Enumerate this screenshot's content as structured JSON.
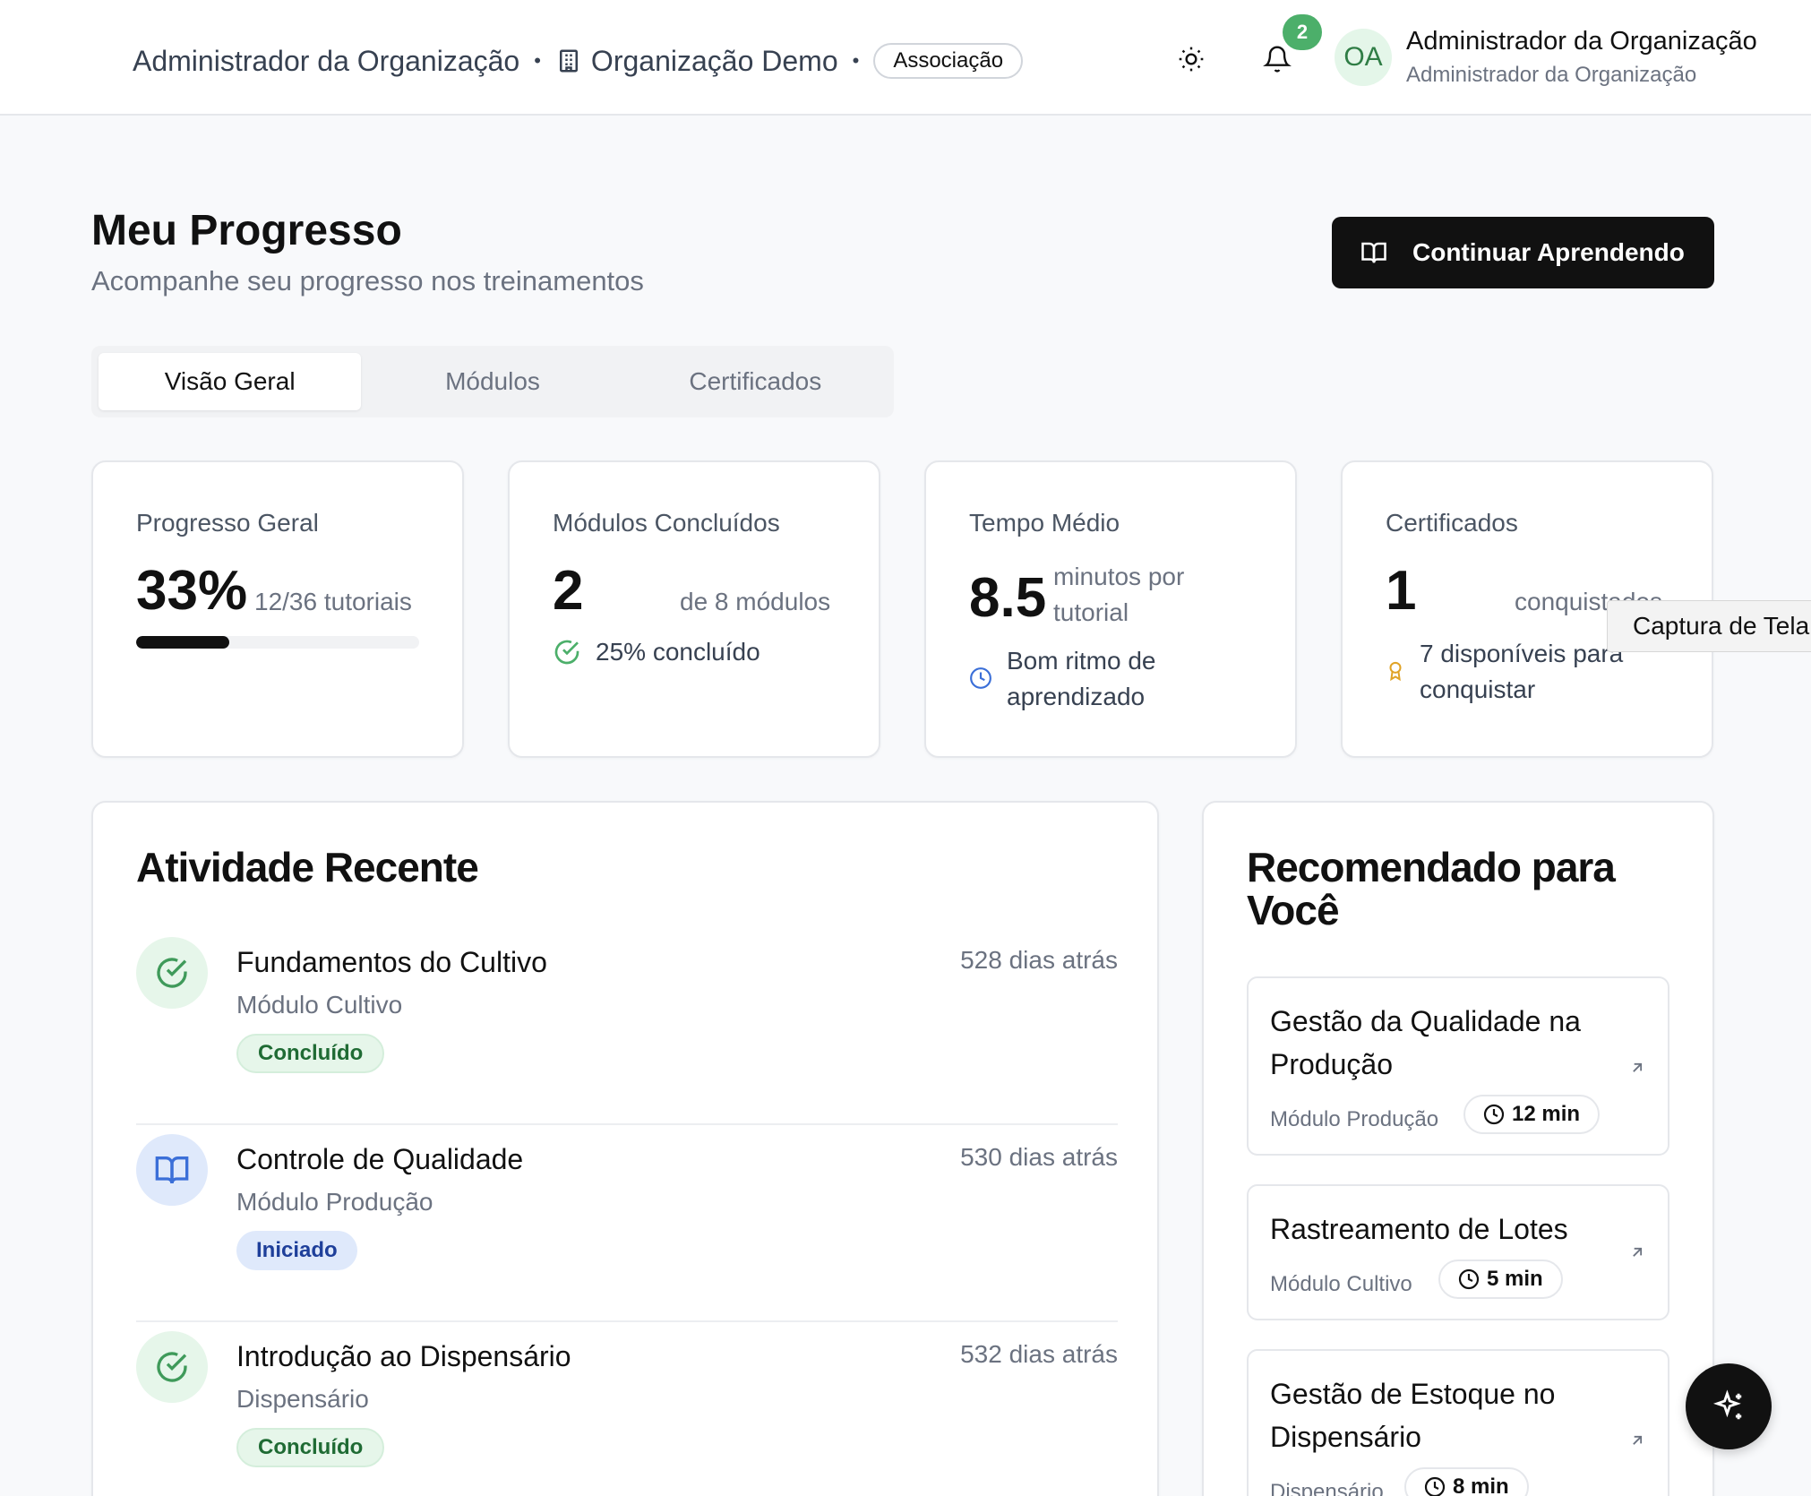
{
  "header": {
    "user_context": "Administrador da Organização",
    "org_name": "Organização Demo",
    "plan_badge": "Associação",
    "notification_count": "2",
    "avatar_initials": "OA",
    "user_name": "Administrador da Organização",
    "user_role": "Administrador da Organização",
    "icons": {
      "org": "building-icon",
      "theme": "sun-icon",
      "notifications": "bell-icon"
    }
  },
  "page": {
    "title": "Meu Progresso",
    "subtitle": "Acompanhe seu progresso nos treinamentos",
    "cta_label": "Continuar Aprendendo"
  },
  "tabs": [
    {
      "label": "Visão Geral",
      "active": true
    },
    {
      "label": "Módulos",
      "active": false
    },
    {
      "label": "Certificados",
      "active": false
    }
  ],
  "stats": {
    "progress": {
      "label": "Progresso Geral",
      "value": "33%",
      "detail": "12/36 tutoriais",
      "fraction": 0.33
    },
    "modules": {
      "label": "Módulos Concluídos",
      "value": "2",
      "detail": "de 8 módulos",
      "foot": "25% concluído"
    },
    "time": {
      "label": "Tempo Médio",
      "value": "8.5",
      "detail_line1": "minutos por",
      "detail_line2": "tutorial",
      "foot_line1": "Bom ritmo de",
      "foot_line2": "aprendizado"
    },
    "certificates": {
      "label": "Certificados",
      "value": "1",
      "detail": "conquistados",
      "foot_line1": "7 disponíveis para",
      "foot_line2": "conquistar"
    }
  },
  "activity": {
    "title": "Atividade Recente",
    "items": [
      {
        "title": "Fundamentos do Cultivo",
        "module": "Módulo Cultivo",
        "status": "Concluído",
        "time": "528 dias atrás",
        "icon": "check-circle-icon"
      },
      {
        "title": "Controle de Qualidade",
        "module": "Módulo Produção",
        "status": "Iniciado",
        "time": "530 dias atrás",
        "icon": "book-open-icon"
      },
      {
        "title": "Introdução ao Dispensário",
        "module": "Dispensário",
        "status": "Concluído",
        "time": "532 dias atrás",
        "icon": "check-circle-icon"
      }
    ]
  },
  "recommended": {
    "title_line1": "Recomendado para",
    "title_line2": "Você",
    "items": [
      {
        "title_line1": "Gestão da Qualidade na",
        "title_line2": "Produção",
        "module": "Módulo Produção",
        "duration": "12 min"
      },
      {
        "title_line1": "Rastreamento de Lotes",
        "module": "Módulo Cultivo",
        "duration": "5 min"
      },
      {
        "title_line1": "Gestão de Estoque no",
        "title_line2": "Dispensário",
        "module": "Dispensário",
        "duration": "8 min"
      }
    ]
  },
  "overlay": {
    "tooltip": "Captura de Tela"
  },
  "colors": {
    "accent": "#111111",
    "success": "#4caf6a",
    "info": "#3b6fd8",
    "award": "#e0a326"
  }
}
